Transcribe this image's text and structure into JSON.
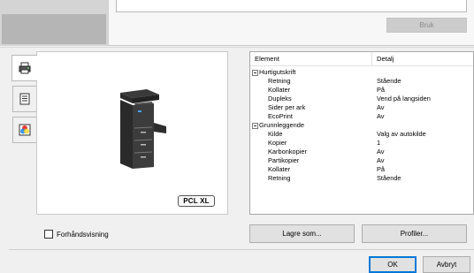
{
  "top": {
    "apply_label": "Bruk"
  },
  "side_tabs": [
    {
      "icon": "printer-icon"
    },
    {
      "icon": "document-icon"
    },
    {
      "icon": "color-icon"
    }
  ],
  "preview": {
    "badge": "PCL XL"
  },
  "table": {
    "headers": {
      "element": "Element",
      "detail": "Detalj"
    },
    "rows": [
      {
        "type": "group",
        "label": "Hurtigutskrift"
      },
      {
        "type": "item",
        "key": "Retning",
        "value": "Stående"
      },
      {
        "type": "item",
        "key": "Kollater",
        "value": "På"
      },
      {
        "type": "item",
        "key": "Dupleks",
        "value": "Vend på langsiden"
      },
      {
        "type": "item",
        "key": "Sider per ark",
        "value": "Av"
      },
      {
        "type": "item",
        "key": "EcoPrint",
        "value": "Av"
      },
      {
        "type": "group",
        "label": "Grunnleggende"
      },
      {
        "type": "item",
        "key": "Kilde",
        "value": "Valg av autokilde"
      },
      {
        "type": "item",
        "key": "Kopier",
        "value": "1"
      },
      {
        "type": "item",
        "key": "Karbonkopier",
        "value": "Av"
      },
      {
        "type": "item",
        "key": "Partikopier",
        "value": "Av"
      },
      {
        "type": "item",
        "key": "Kollater",
        "value": "På"
      },
      {
        "type": "item",
        "key": "Retning",
        "value": "Stående"
      }
    ]
  },
  "footer": {
    "preview_checkbox": "Forhåndsvisning",
    "save_as": "Lagre som...",
    "profiles": "Profiler...",
    "ok": "OK",
    "cancel": "Avbryt"
  },
  "colors": {
    "ok_border": "#0078d7",
    "button_bg": "#e1e1e1"
  }
}
